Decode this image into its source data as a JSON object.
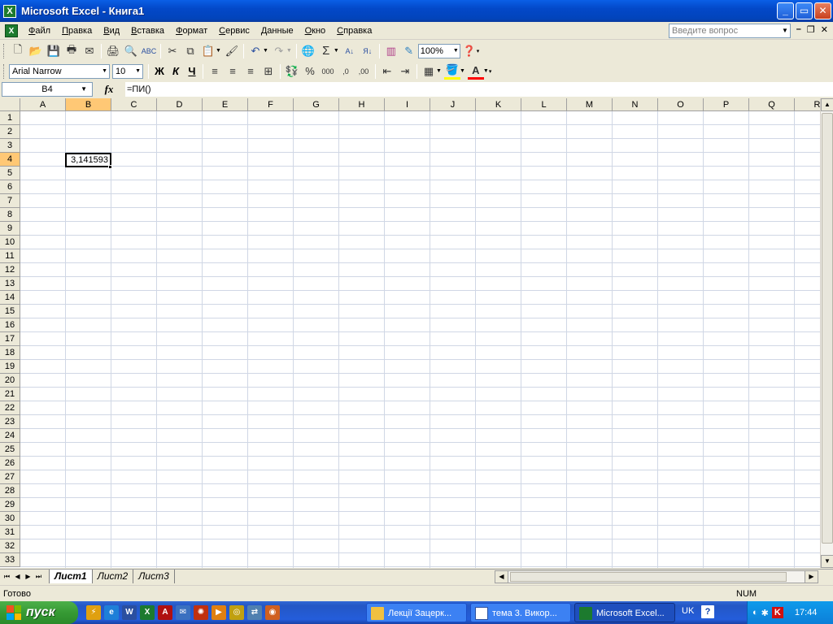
{
  "window": {
    "title": "Microsoft Excel - Книга1",
    "minimize": "_",
    "maximize": "▭",
    "close": "✕"
  },
  "menu": {
    "items": [
      "Файл",
      "Правка",
      "Вид",
      "Вставка",
      "Формат",
      "Сервис",
      "Данные",
      "Окно",
      "Справка"
    ],
    "help_placeholder": "Введите вопрос"
  },
  "toolbar": {
    "zoom": "100%",
    "font_name": "Arial Narrow",
    "font_size": "10",
    "bold": "Ж",
    "italic": "К",
    "underline": "Ч",
    "thousands": "000",
    "percent": "%"
  },
  "formula_bar": {
    "name_box": "B4",
    "fx": "fx",
    "formula": "=ПИ()"
  },
  "sheet": {
    "columns": [
      "A",
      "B",
      "C",
      "D",
      "E",
      "F",
      "G",
      "H",
      "I",
      "J",
      "K",
      "L",
      "M",
      "N",
      "O",
      "P",
      "Q",
      "R"
    ],
    "rows": [
      "1",
      "2",
      "3",
      "4",
      "5",
      "6",
      "7",
      "8",
      "9",
      "10",
      "11",
      "12",
      "13",
      "14",
      "15",
      "16",
      "17",
      "18",
      "19",
      "20",
      "21",
      "22",
      "23",
      "24",
      "25",
      "26",
      "27",
      "28",
      "29",
      "30",
      "31",
      "32",
      "33"
    ],
    "selected_column": "B",
    "selected_row": "4",
    "active_cell_value": "3,141593"
  },
  "tabs": {
    "sheets": [
      "Лист1",
      "Лист2",
      "Лист3"
    ],
    "active": "Лист1"
  },
  "status": {
    "text": "Готово",
    "num": "NUM"
  },
  "taskbar": {
    "start": "пуск",
    "tasks": [
      "Лекції Зацерк...",
      "тема 3. Викор...",
      "Microsoft Excel..."
    ],
    "lang": "UK",
    "clock": "17:44"
  }
}
